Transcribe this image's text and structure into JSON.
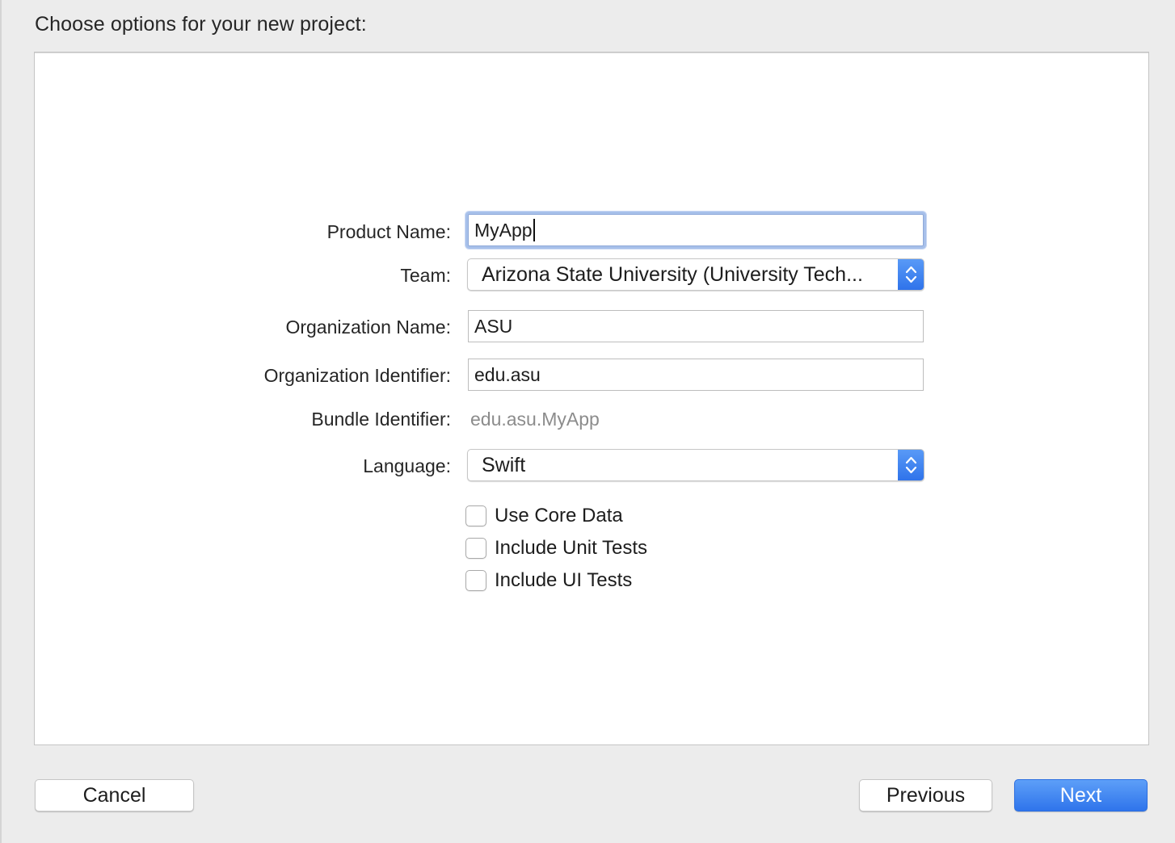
{
  "dialog": {
    "heading": "Choose options for your new project:"
  },
  "form": {
    "product_name": {
      "label": "Product Name:",
      "value": "MyApp"
    },
    "team": {
      "label": "Team:",
      "value": "Arizona State University (University Tech..."
    },
    "organization_name": {
      "label": "Organization Name:",
      "value": "ASU"
    },
    "organization_identifier": {
      "label": "Organization Identifier:",
      "value": "edu.asu"
    },
    "bundle_identifier": {
      "label": "Bundle Identifier:",
      "value": "edu.asu.MyApp"
    },
    "language": {
      "label": "Language:",
      "value": "Swift"
    },
    "checkboxes": [
      {
        "label": "Use Core Data",
        "checked": false
      },
      {
        "label": "Include Unit Tests",
        "checked": false
      },
      {
        "label": "Include UI Tests",
        "checked": false
      }
    ]
  },
  "footer": {
    "cancel_label": "Cancel",
    "previous_label": "Previous",
    "next_label": "Next"
  },
  "colors": {
    "accent": "#3b82f0",
    "focus_ring": "#a7c0ea",
    "window_bg": "#ececec",
    "panel_bg": "#ffffff",
    "secondary_text": "#8c8c8c"
  },
  "icons": {
    "popup_arrows": "chevron-up-down-icon"
  }
}
